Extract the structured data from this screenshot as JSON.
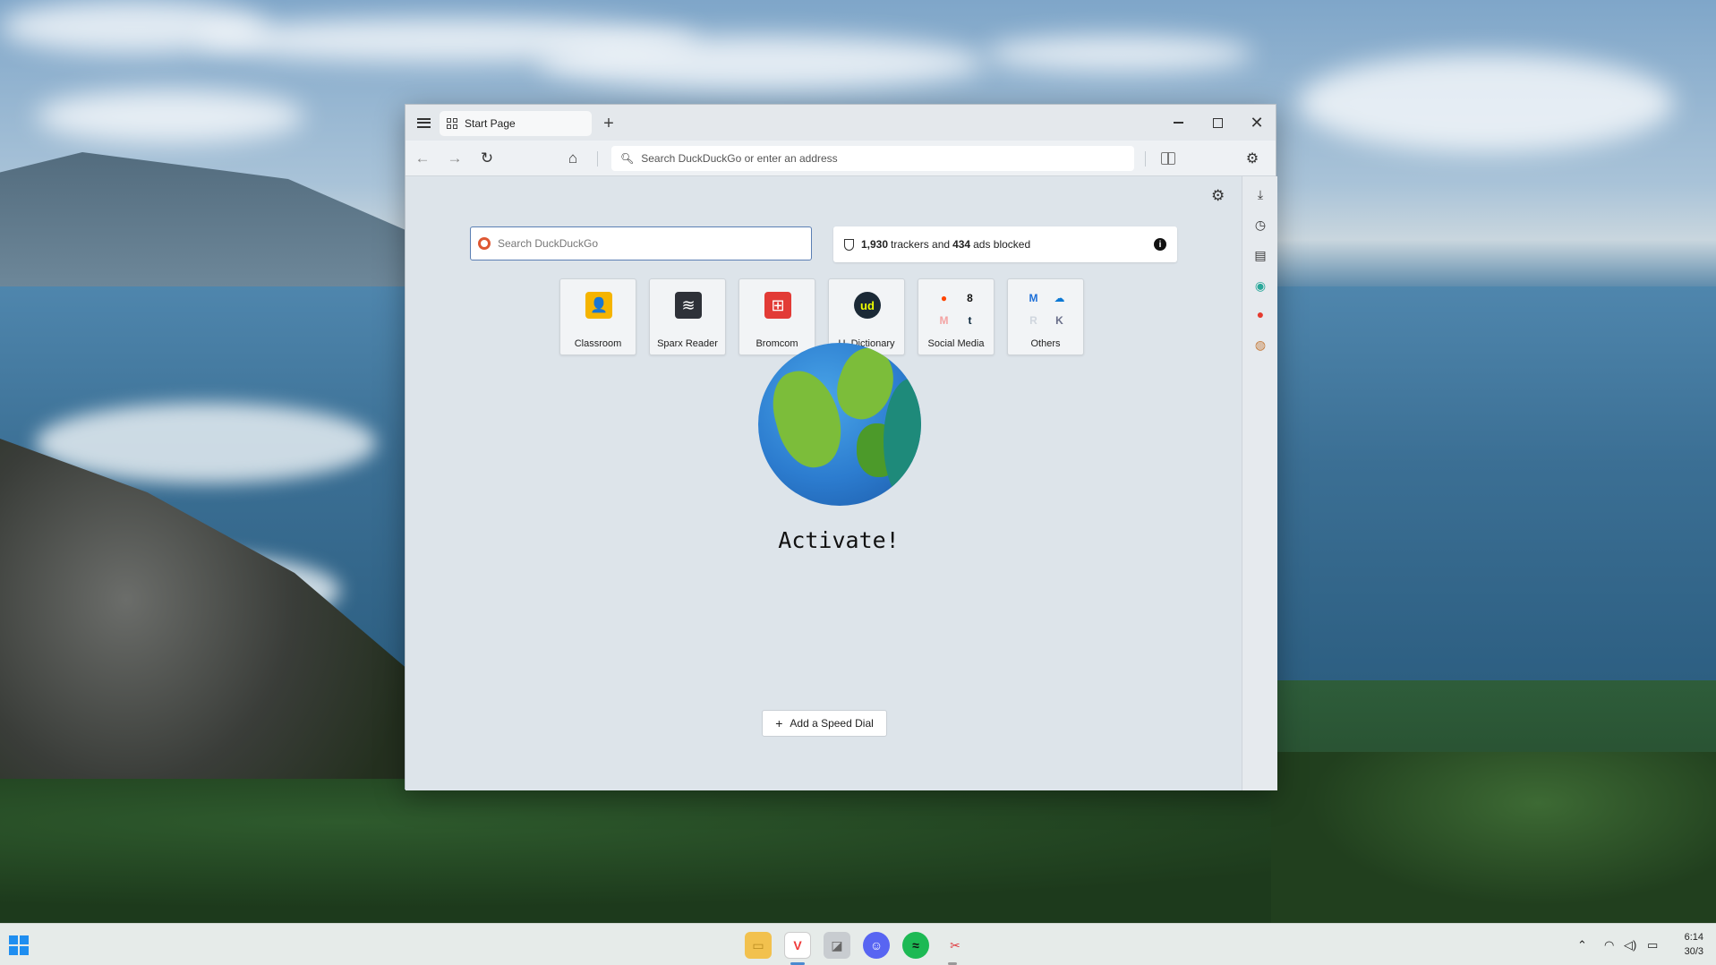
{
  "browser": {
    "tab_title": "Start Page",
    "address_placeholder": "Search DuckDuckGo or enter an address"
  },
  "start_page": {
    "search_placeholder": "Search DuckDuckGo",
    "trackers_count": "1,930",
    "trackers_text": "trackers and",
    "ads_count": "434",
    "ads_text": "ads blocked",
    "info_glyph": "i",
    "speed_dials": [
      {
        "label": "Classroom",
        "icon": "google-classroom-icon",
        "glyph": "👤"
      },
      {
        "label": "Sparx Reader",
        "icon": "sparx-reader-icon",
        "glyph": "≋"
      },
      {
        "label": "Bromcom",
        "icon": "bromcom-icon",
        "glyph": "⊞"
      },
      {
        "label": "U. Dictionary",
        "icon": "urban-dictionary-icon",
        "glyph": "ud"
      },
      {
        "label": "Social Media",
        "icon": "social-media-folder-icon",
        "glyphs": [
          "●",
          "8",
          "M",
          "t"
        ]
      },
      {
        "label": "Others",
        "icon": "others-folder-icon",
        "glyphs": [
          "M",
          "☁",
          "R",
          "K"
        ]
      }
    ],
    "tagline": "Activate!",
    "add_speed_dial_label": "Add a Speed Dial"
  },
  "colors": {
    "accent": "#5b7fb4",
    "ddg_orange": "#de5833",
    "bromcom_red": "#e23b36",
    "vivaldi_red": "#ef3939",
    "discord": "#5865f2",
    "spotify": "#1db954"
  },
  "taskbar": {
    "apps": [
      "file-explorer-icon",
      "vivaldi-icon",
      "app-icon",
      "discord-icon",
      "spotify-icon",
      "snipping-tool-icon"
    ],
    "time": "6:14",
    "date": "30/3"
  }
}
